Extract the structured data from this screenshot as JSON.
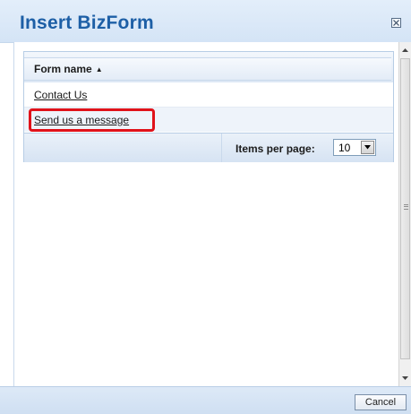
{
  "dialog": {
    "title": "Insert BizForm",
    "close_icon": "close-box-icon"
  },
  "grid": {
    "column_header": "Form name",
    "sort_direction": "ascending",
    "sort_glyph": "▲",
    "rows": [
      {
        "label": "Contact Us"
      },
      {
        "label": "Send us a message"
      }
    ],
    "pager": {
      "items_per_page_label": "Items per page:",
      "items_per_page_value": "10"
    }
  },
  "footer": {
    "cancel_label": "Cancel"
  },
  "colors": {
    "title": "#1d5fa6",
    "highlight": "#e0121a",
    "header_bg": "#d4e4f6"
  }
}
